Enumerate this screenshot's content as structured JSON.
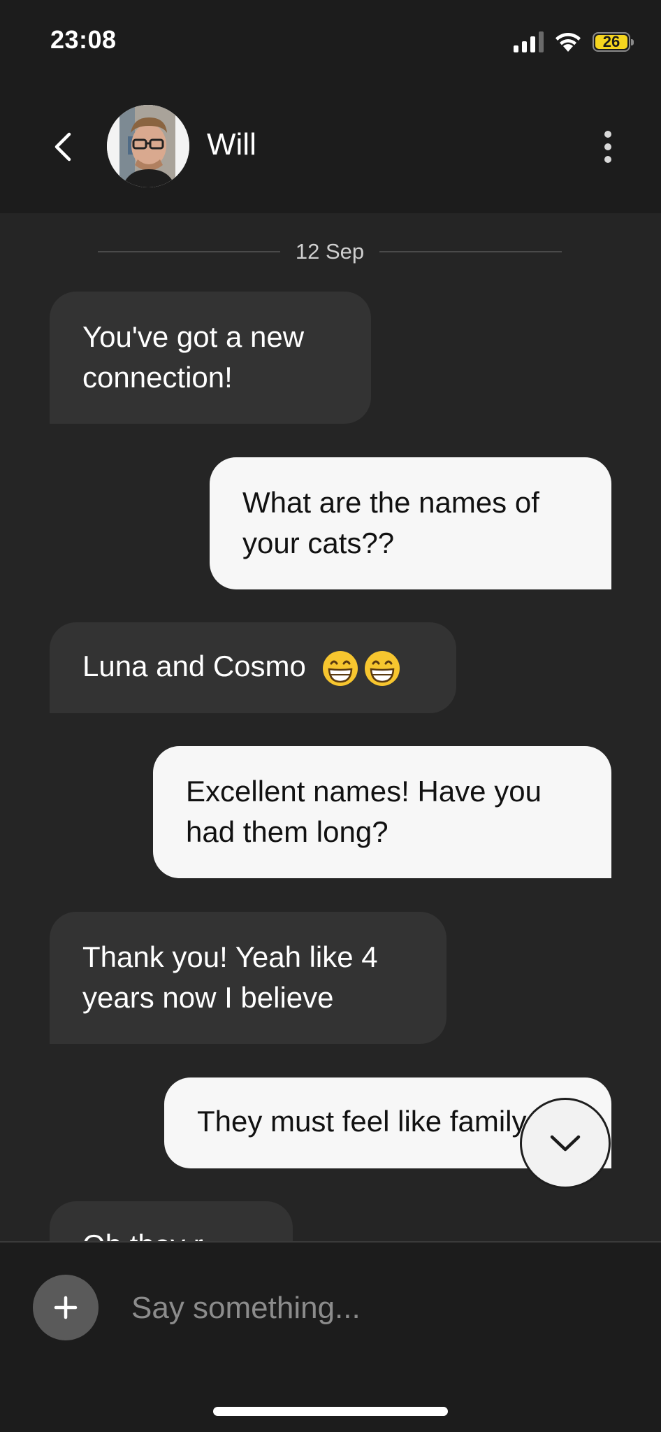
{
  "status_bar": {
    "time": "23:08",
    "battery_level": "26",
    "icons": [
      "signal-icon",
      "wifi-icon",
      "battery-icon"
    ]
  },
  "header": {
    "contact_name": "Will",
    "back_icon": "chevron-left-icon",
    "avatar": "avatar",
    "more_icon": "vertical-ellipsis-icon"
  },
  "chat": {
    "date_label": "12 Sep",
    "messages": [
      {
        "side": "in",
        "text": "You've got a new connection!"
      },
      {
        "side": "out",
        "text": "What are the names of your cats??"
      },
      {
        "side": "in",
        "text": "Luna and Cosmo",
        "emojis": [
          "grin-icon",
          "grin-icon"
        ]
      },
      {
        "side": "out",
        "text": "Excellent names! Have you had them long?"
      },
      {
        "side": "in",
        "text": "Thank you! Yeah like 4 years now I believe"
      },
      {
        "side": "out",
        "text": "They must feel like family"
      },
      {
        "side": "in",
        "text": "Oh they r"
      }
    ],
    "scroll_down_icon": "chevron-down-icon"
  },
  "composer": {
    "add_icon": "plus-icon",
    "placeholder": "Say something..."
  },
  "colors": {
    "background": "#252525",
    "bar_background": "#1c1c1c",
    "incoming_bubble": "#333333",
    "outgoing_bubble": "#f7f7f7",
    "battery": "#f5d51f"
  }
}
